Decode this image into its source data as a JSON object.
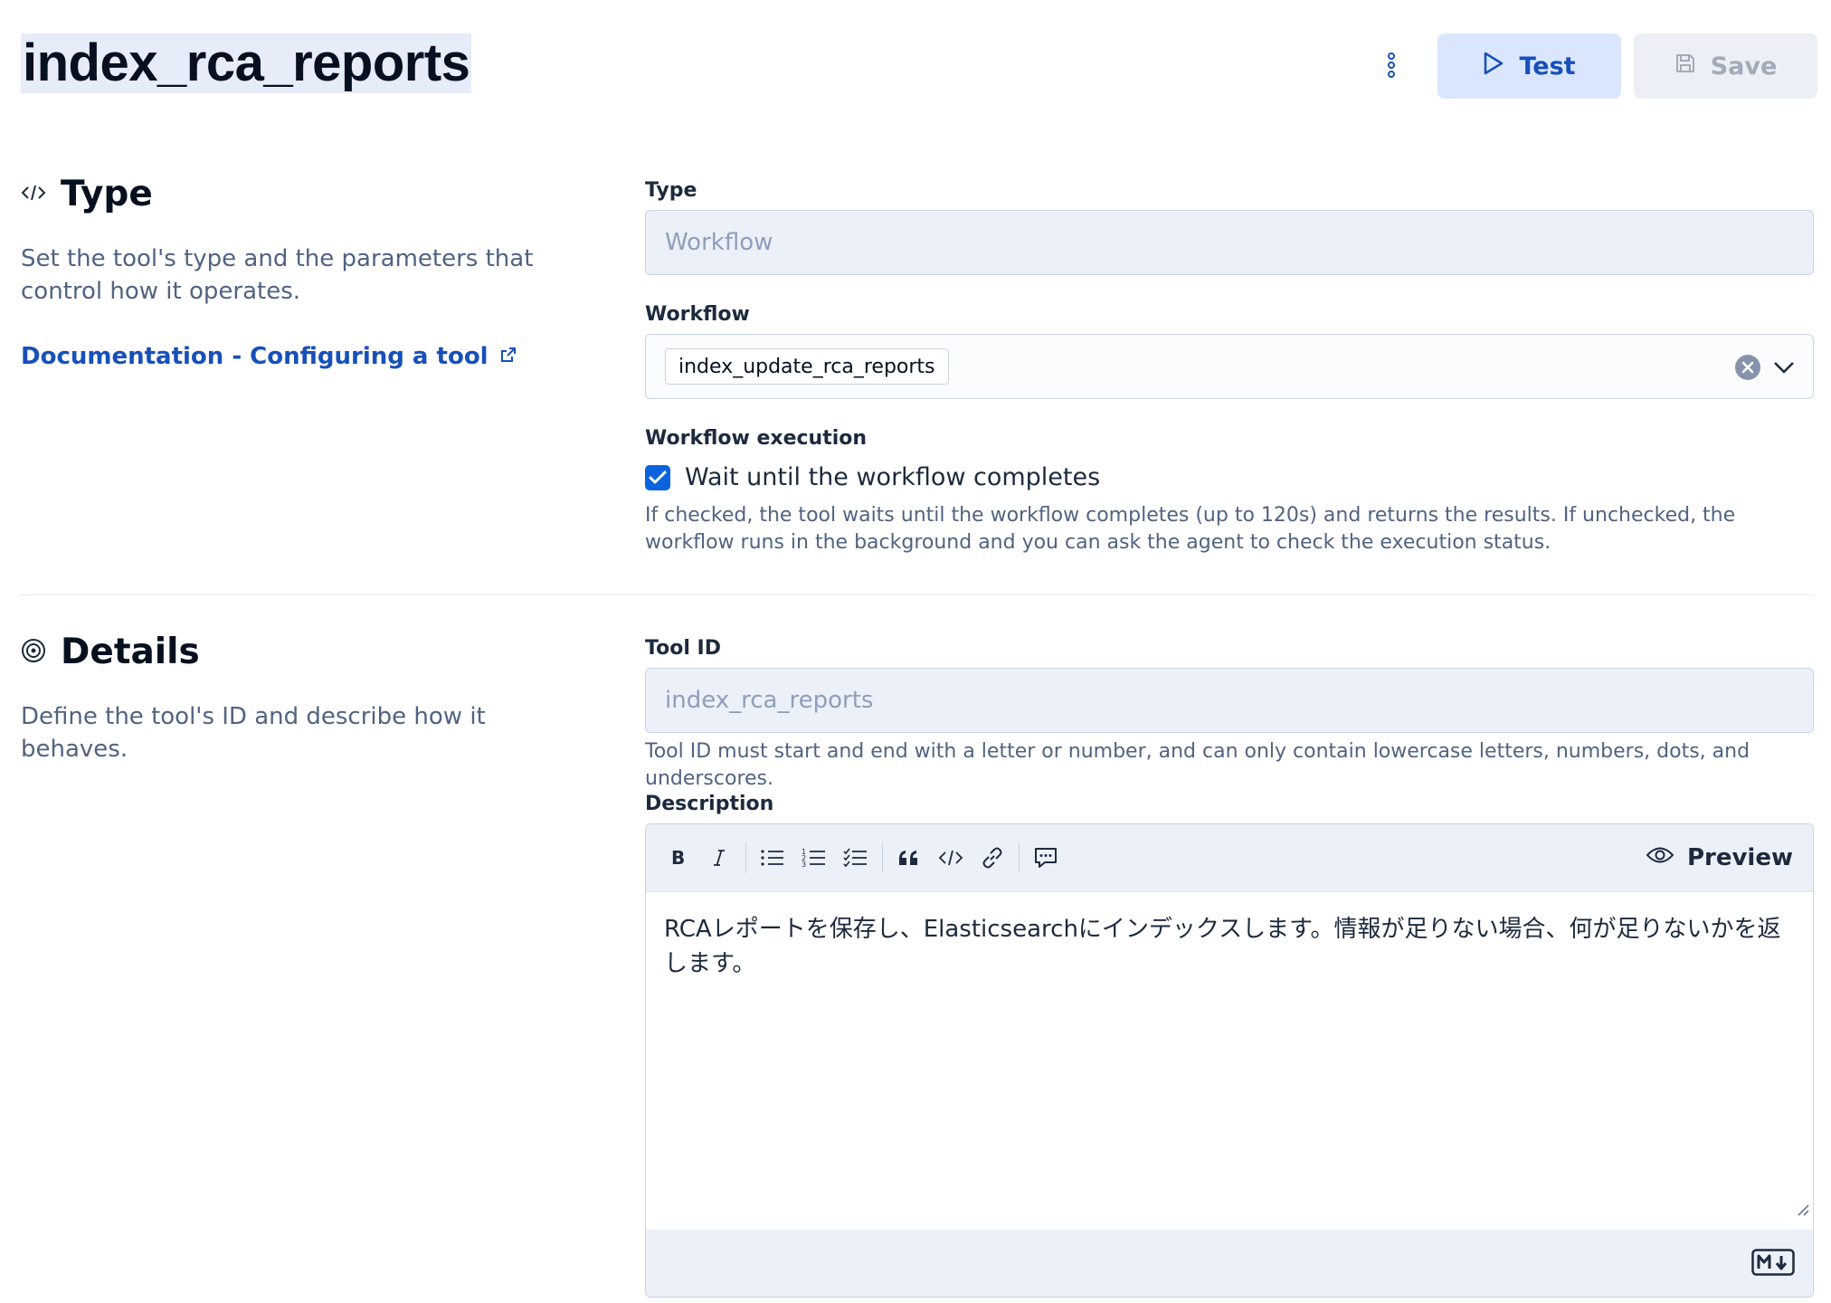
{
  "header": {
    "title": "index_rca_reports",
    "test_label": "Test",
    "save_label": "Save"
  },
  "type_section": {
    "title": "Type",
    "description": "Set the tool's type and the parameters that control how it operates.",
    "doc_link": "Documentation - Configuring a tool",
    "type_label": "Type",
    "type_value": "Workflow",
    "workflow_label": "Workflow",
    "workflow_value": "index_update_rca_reports",
    "execution_label": "Workflow execution",
    "wait_label": "Wait until the workflow completes",
    "wait_checked": true,
    "wait_help": "If checked, the tool waits until the workflow completes (up to 120s) and returns the results. If unchecked, the workflow runs in the background and you can ask the agent to check the execution status."
  },
  "details_section": {
    "title": "Details",
    "description": "Define the tool's ID and describe how it behaves.",
    "tool_id_label": "Tool ID",
    "tool_id_value": "index_rca_reports",
    "tool_id_help": "Tool ID must start and end with a letter or number, and can only contain lowercase letters, numbers, dots, and underscores.",
    "description_label": "Description",
    "preview_label": "Preview",
    "description_text": "RCAレポートを保存し、Elasticsearchにインデックスします。情報が足りない場合、何が足りないかを返します。",
    "toolbar_icons": [
      "bold-icon",
      "italic-icon",
      "bullet-list-icon",
      "numbered-list-icon",
      "task-list-icon",
      "quote-icon",
      "code-icon",
      "link-icon",
      "comment-icon"
    ]
  },
  "colors": {
    "accent": "#1750ba",
    "primary_fill": "#d9e6fe",
    "checkbox": "#0b64dd",
    "disabled_field": "#ecf0f8"
  }
}
